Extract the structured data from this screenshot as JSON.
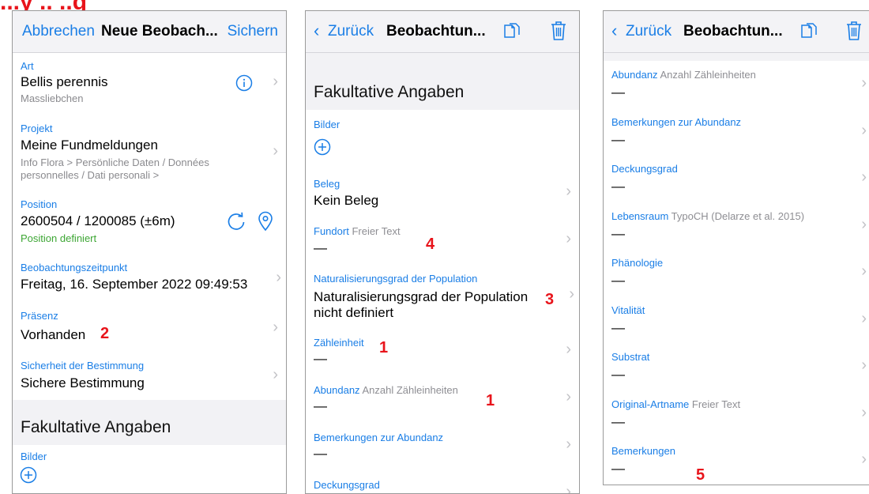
{
  "corner_label": "...y .. ..g",
  "screen1": {
    "nav": {
      "cancel": "Abbrechen",
      "title": "Neue Beobach...",
      "save": "Sichern"
    },
    "art": {
      "label": "Art",
      "value": "Bellis perennis",
      "common": "Massliebchen"
    },
    "projekt": {
      "label": "Projekt",
      "value": "Meine Fundmeldungen",
      "path1": "Info Flora > Persönliche Daten / Données",
      "path2": "personnelles / Dati personali >"
    },
    "position": {
      "label": "Position",
      "value": "2600504 / 1200085 (±6m)",
      "status": "Position definiert"
    },
    "zeit": {
      "label": "Beobachtungszeitpunkt",
      "value": "Freitag, 16. September 2022 09:49:53"
    },
    "praesenz": {
      "label": "Präsenz",
      "value": "Vorhanden",
      "marker": "2"
    },
    "sicherheit": {
      "label": "Sicherheit der Bestimmung",
      "value": "Sichere Bestimmung"
    },
    "section": "Fakultative Angaben",
    "bilder": "Bilder"
  },
  "screen2": {
    "nav": {
      "back": "Zurück",
      "title": "Beobachtun..."
    },
    "section": "Fakultative Angaben",
    "bilder": "Bilder",
    "beleg": {
      "label": "Beleg",
      "value": "Kein Beleg"
    },
    "fundort": {
      "label": "Fundort",
      "hint": "Freier Text",
      "value": "—",
      "marker": "4"
    },
    "natur": {
      "label": "Naturalisierungsgrad der Population",
      "value1": "Naturalisierungsgrad der Population",
      "value2": "nicht definiert",
      "marker": "3"
    },
    "zaehl": {
      "label": "Zähleinheit",
      "value": "—",
      "marker": "1"
    },
    "abundanz": {
      "label": "Abundanz",
      "hint": "Anzahl Zähleinheiten",
      "value": "—",
      "marker": "1"
    },
    "bem_ab": {
      "label": "Bemerkungen zur Abundanz",
      "value": "—"
    },
    "deckung": {
      "label": "Deckungsgrad"
    }
  },
  "screen3": {
    "nav": {
      "back": "Zurück",
      "title": "Beobachtun..."
    },
    "rows": [
      {
        "label": "Abundanz",
        "hint": "Anzahl Zähleinheiten",
        "value": "—"
      },
      {
        "label": "Bemerkungen zur Abundanz",
        "hint": "",
        "value": "—"
      },
      {
        "label": "Deckungsgrad",
        "hint": "",
        "value": "—"
      },
      {
        "label": "Lebensraum",
        "hint": "TypoCH (Delarze et al. 2015)",
        "value": "—"
      },
      {
        "label": "Phänologie",
        "hint": "",
        "value": "—"
      },
      {
        "label": "Vitalität",
        "hint": "",
        "value": "—"
      },
      {
        "label": "Substrat",
        "hint": "",
        "value": "—"
      },
      {
        "label": "Original-Artname",
        "hint": "Freier Text",
        "value": "—"
      },
      {
        "label": "Bemerkungen",
        "hint": "",
        "value": "—"
      }
    ],
    "marker": "5"
  },
  "colors": {
    "accent": "#1a7ee6",
    "annotation": "#e8141b",
    "status_ok": "#3da634"
  },
  "icons": [
    "info-icon",
    "refresh-icon",
    "location-pin-icon",
    "copy-icon",
    "trash-icon",
    "add-circle-icon",
    "chevron-right-icon",
    "chevron-left-icon"
  ]
}
